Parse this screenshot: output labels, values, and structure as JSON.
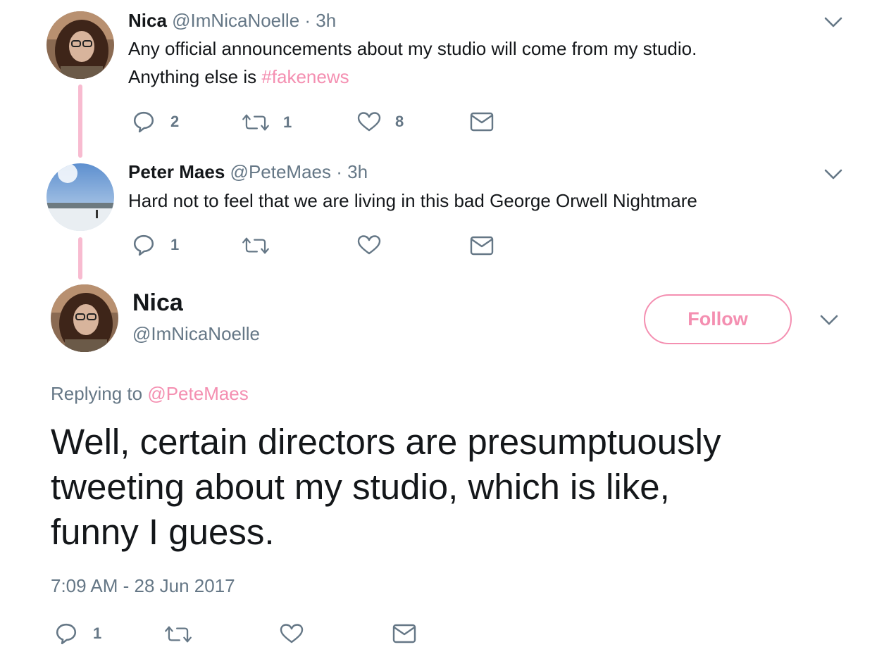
{
  "colors": {
    "accent": "#f48fb1",
    "thread_line": "#f8bbd0",
    "muted": "#657786",
    "text": "#14171a"
  },
  "tweet1": {
    "name": "Nica",
    "handle": "@ImNicaNoelle",
    "sep": "·",
    "time": "3h",
    "text_line1": "Any official announcements about my studio will come from my studio.",
    "text_line2_prefix": "Anything else is ",
    "hashtag": "#fakenews",
    "replies": "2",
    "retweets": "1",
    "likes": "8"
  },
  "tweet2": {
    "name": "Peter Maes",
    "handle": "@PeteMaes",
    "sep": "·",
    "time": "3h",
    "text": "Hard not to feel that we are living in this bad George Orwell Nightmare",
    "replies": "1"
  },
  "main": {
    "name": "Nica",
    "handle": "@ImNicaNoelle",
    "follow_label": "Follow",
    "replying_prefix": "Replying to ",
    "replying_handle": "@PeteMaes",
    "text_line1": "Well, certain directors are presumptuously",
    "text_line2": "tweeting about my studio, which is like,",
    "text_line3": "funny I guess.",
    "timestamp": "7:09 AM - 28 Jun 2017",
    "replies": "1"
  },
  "icons": [
    "chevron-down-icon",
    "reply-icon",
    "retweet-icon",
    "like-icon",
    "message-icon"
  ]
}
